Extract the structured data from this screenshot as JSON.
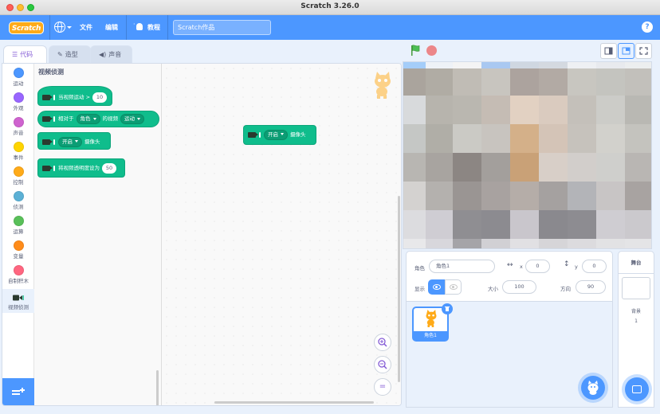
{
  "window": {
    "title": "Scratch 3.26.0"
  },
  "menubar": {
    "logo": "Scratch",
    "file": "文件",
    "edit": "编辑",
    "tutorials": "教程",
    "project_title": "Scratch作品",
    "help": "?"
  },
  "tabs": [
    {
      "label": "代码",
      "icon": "code-icon",
      "active": true
    },
    {
      "label": "造型",
      "icon": "brush-icon",
      "active": false
    },
    {
      "label": "声音",
      "icon": "speaker-icon",
      "active": false
    }
  ],
  "categories": [
    {
      "label": "运动",
      "color": "#4c97ff"
    },
    {
      "label": "外观",
      "color": "#9966ff"
    },
    {
      "label": "声音",
      "color": "#cf63cf"
    },
    {
      "label": "事件",
      "color": "#ffd500"
    },
    {
      "label": "控制",
      "color": "#ffab19"
    },
    {
      "label": "侦测",
      "color": "#5cb1d6"
    },
    {
      "label": "运算",
      "color": "#59c059"
    },
    {
      "label": "变量",
      "color": "#ff8c1a"
    },
    {
      "label": "自制积木",
      "color": "#ff6680"
    },
    {
      "label": "视频侦测",
      "color": "#0fbd8c",
      "selected": true
    }
  ],
  "flyout": {
    "title": "视频侦测",
    "blocks": {
      "motion_hat": {
        "text": "当视频运动 >",
        "value": "10"
      },
      "relative": {
        "text1": "相对于",
        "attr": "角色",
        "text2": "的视频",
        "type": "运动"
      },
      "turn_on": {
        "state": "开启",
        "text": "摄像头"
      },
      "transparency": {
        "text": "将视频透明度设为",
        "value": "50"
      }
    }
  },
  "workspace": {
    "block": {
      "state": "开启",
      "text": "摄像头"
    },
    "zoom_reset": "="
  },
  "sprite_info": {
    "sprite_label": "角色",
    "sprite_name": "角色1",
    "x_label": "x",
    "x_value": "0",
    "y_label": "y",
    "y_value": "0",
    "show_label": "显示",
    "size_label": "大小",
    "size_value": "100",
    "direction_label": "方向",
    "direction_value": "90"
  },
  "sprites": [
    {
      "name": "角色1",
      "selected": true
    }
  ],
  "stage_pane": {
    "title": "舞台",
    "backdrops_label": "背景",
    "backdrops_count": "1"
  },
  "colors": {
    "accent": "#4c97ff",
    "video_block": "#0fbd8c",
    "code_tab": "#855cd6"
  }
}
